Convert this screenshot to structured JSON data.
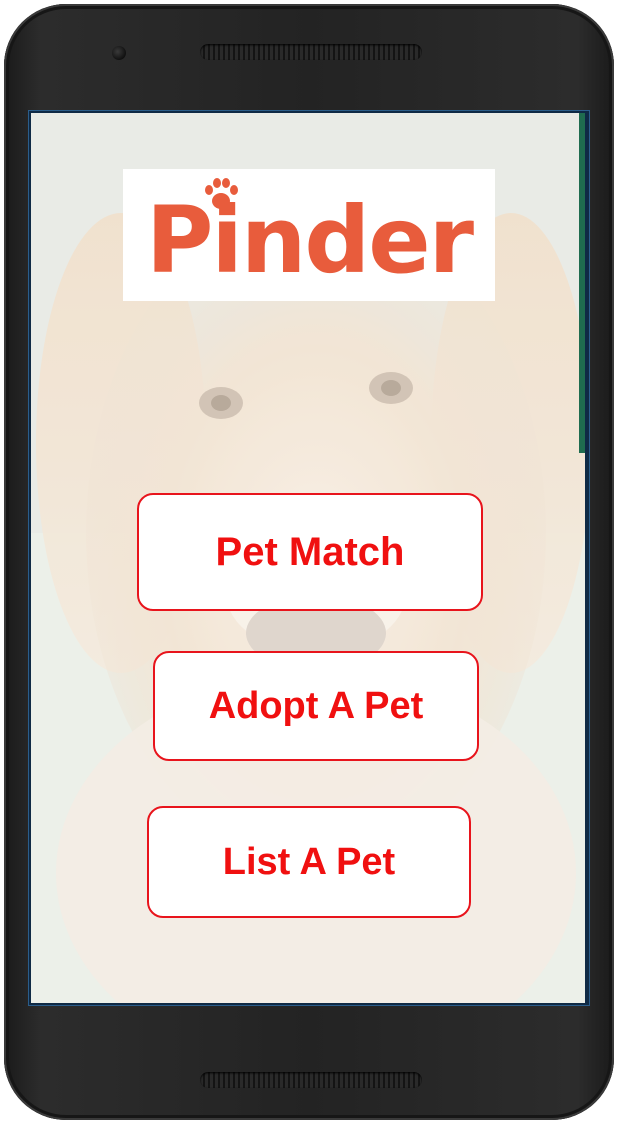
{
  "app": {
    "logo_text": "Pinder"
  },
  "buttons": {
    "pet_match": "Pet Match",
    "adopt_pet": "Adopt A Pet",
    "list_pet": "List A Pet"
  },
  "colors": {
    "brand": "#e85c3c",
    "button_text": "#f01010",
    "button_border": "#e8141c"
  },
  "icons": {
    "logo_mark": "paw-icon"
  }
}
